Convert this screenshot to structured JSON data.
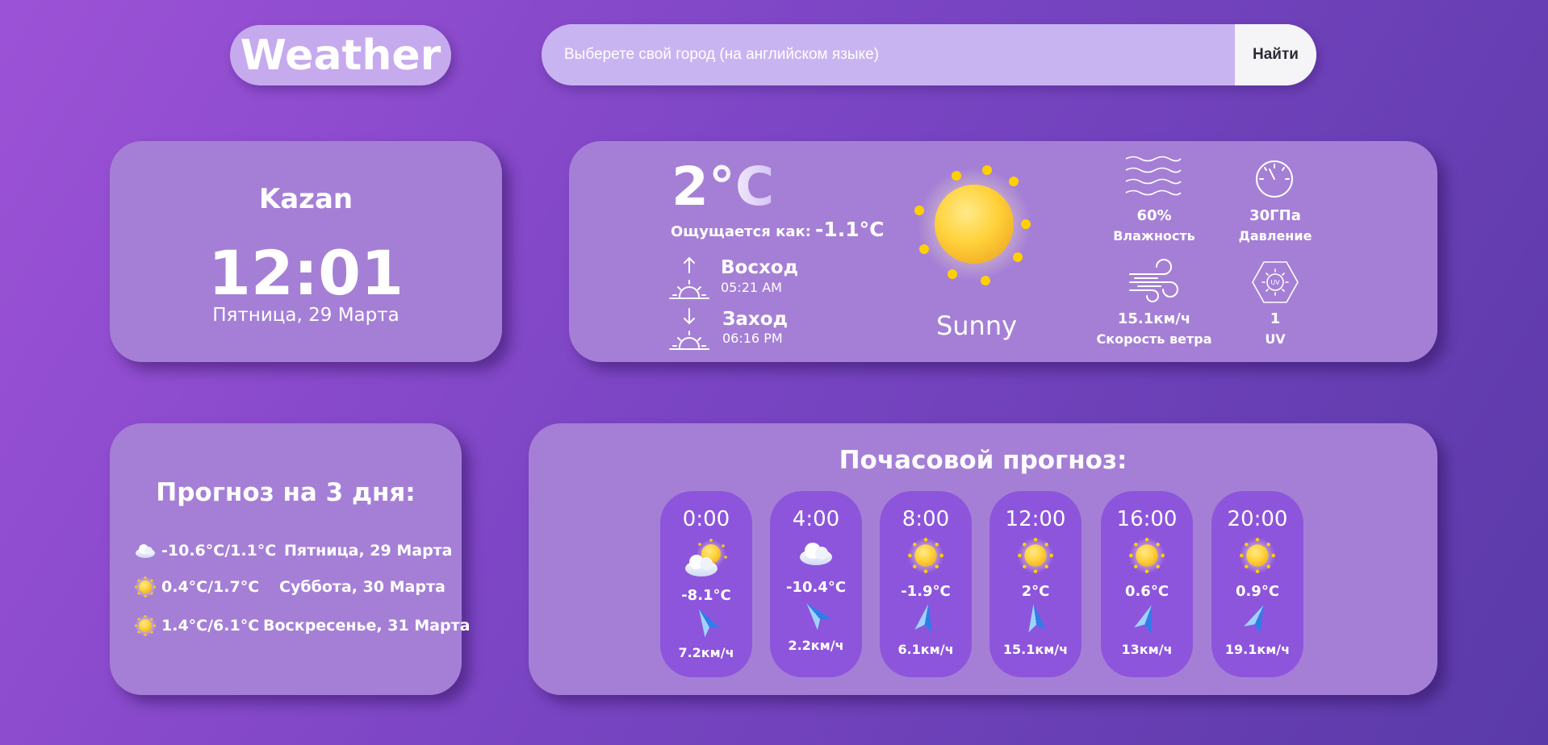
{
  "header": {
    "logo": "Weather",
    "search_placeholder": "Выберете свой город (на английском языке)",
    "search_button": "Найти"
  },
  "city": {
    "name": "Kazan",
    "time": "12:01",
    "date": "Пятница, 29 Марта"
  },
  "current": {
    "temp": "2°C",
    "feels_label": "Ощущается как:",
    "feels_value": "-1.1°C",
    "sunrise_label": "Восход",
    "sunrise_time": "05:21 AM",
    "sunset_label": "Заход",
    "sunset_time": "06:16 PM",
    "condition": "Sunny",
    "icon": "sun-icon",
    "humidity_value": "60%",
    "humidity_label": "Влажность",
    "pressure_value": "30ГПа",
    "pressure_label": "Давление",
    "wind_value": "15.1км/ч",
    "wind_label": "Скорость ветра",
    "uv_value": "1",
    "uv_label": "UV"
  },
  "forecast3": {
    "title": "Прогноз на 3 дня:",
    "days": [
      {
        "icon": "cloud-icon",
        "temps": "-10.6°C/1.1°C",
        "date": "Пятница, 29 Марта"
      },
      {
        "icon": "sun-icon",
        "temps": "0.4°C/1.7°C",
        "date": "Суббота, 30 Марта"
      },
      {
        "icon": "sun-icon",
        "temps": "1.4°C/6.1°C",
        "date": "Воскресенье, 31 Марта"
      }
    ]
  },
  "hourly": {
    "title": "Почасовой прогноз:",
    "items": [
      {
        "time": "0:00",
        "icon": "partly-cloudy-icon",
        "temp": "-8.1°C",
        "wind": "7.2км/ч"
      },
      {
        "time": "4:00",
        "icon": "cloud-icon",
        "temp": "-10.4°C",
        "wind": "2.2км/ч"
      },
      {
        "time": "8:00",
        "icon": "sun-icon",
        "temp": "-1.9°C",
        "wind": "6.1км/ч"
      },
      {
        "time": "12:00",
        "icon": "sun-icon",
        "temp": "2°C",
        "wind": "15.1км/ч"
      },
      {
        "time": "16:00",
        "icon": "sun-icon",
        "temp": "0.6°C",
        "wind": "13км/ч"
      },
      {
        "time": "20:00",
        "icon": "sun-icon",
        "temp": "0.9°C",
        "wind": "19.1км/ч"
      }
    ]
  },
  "colors": {
    "card": "#a57fd6",
    "hour_card": "#8d55dc",
    "sun": "#ffd23a",
    "wind_arrow": "#3a8ef0"
  }
}
